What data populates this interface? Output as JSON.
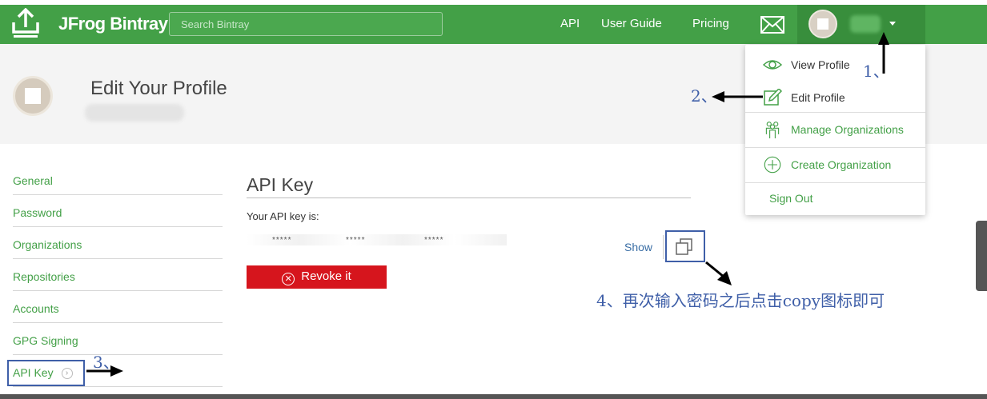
{
  "nav": {
    "brand": "JFrog Bintray",
    "search_placeholder": "Search Bintray",
    "links": [
      "API",
      "User Guide",
      "Pricing"
    ]
  },
  "profile": {
    "title": "Edit Your Profile"
  },
  "sidebar": {
    "items": [
      {
        "label": "General"
      },
      {
        "label": "Password"
      },
      {
        "label": "Organizations"
      },
      {
        "label": "Repositories"
      },
      {
        "label": "Accounts"
      },
      {
        "label": "GPG Signing"
      },
      {
        "label": "API Key"
      }
    ]
  },
  "api_key": {
    "title": "API Key",
    "label": "Your API key is:",
    "masked_parts": [
      "*****",
      "*****",
      "*****"
    ],
    "show": "Show",
    "revoke": "Revoke it"
  },
  "dropdown": {
    "items": [
      "View Profile",
      "Edit Profile",
      "Manage Organizations",
      "Create Organization",
      "Sign Out"
    ]
  },
  "annotations": {
    "step1": "1、",
    "step2": "2、",
    "step3": "3、",
    "step4": "4、再次输入密码之后点击copy图标即可"
  },
  "colors": {
    "nav_green": "#43a047",
    "nav_dark_green": "#388e3c",
    "link_green": "#43a047",
    "revoke_red": "#d6151d",
    "annotation_blue": "#3f5fa8"
  }
}
